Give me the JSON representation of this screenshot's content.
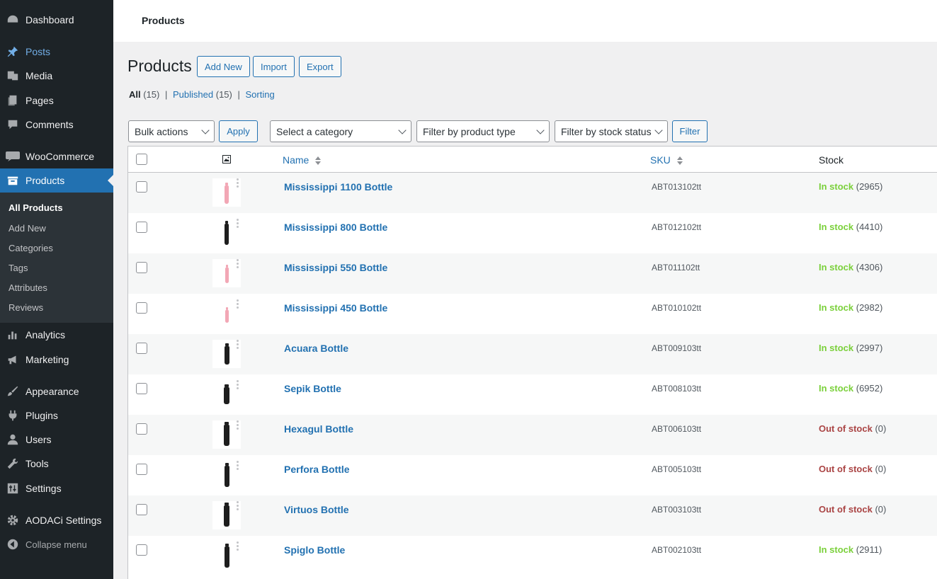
{
  "sidebar": {
    "menu": [
      {
        "label": "Dashboard",
        "icon": "dashboard-icon"
      },
      {
        "label": "Posts",
        "icon": "pin-icon"
      },
      {
        "label": "Media",
        "icon": "media-icon"
      },
      {
        "label": "Pages",
        "icon": "pages-icon"
      },
      {
        "label": "Comments",
        "icon": "comment-icon"
      },
      {
        "label": "WooCommerce",
        "icon": "woo-icon"
      },
      {
        "label": "Products",
        "icon": "archive-icon"
      },
      {
        "label": "Analytics",
        "icon": "bar-chart-icon"
      },
      {
        "label": "Marketing",
        "icon": "megaphone-icon"
      },
      {
        "label": "Appearance",
        "icon": "brush-icon"
      },
      {
        "label": "Plugins",
        "icon": "plug-icon"
      },
      {
        "label": "Users",
        "icon": "user-icon"
      },
      {
        "label": "Tools",
        "icon": "wrench-icon"
      },
      {
        "label": "Settings",
        "icon": "sliders-icon"
      },
      {
        "label": "AODACi Settings",
        "icon": "gear-icon"
      },
      {
        "label": "Collapse menu",
        "icon": "collapse-icon"
      }
    ],
    "submenu": [
      "All Products",
      "Add New",
      "Categories",
      "Tags",
      "Attributes",
      "Reviews"
    ]
  },
  "topbar": {
    "title": "Products"
  },
  "header": {
    "title": "Products",
    "add_new": "Add New",
    "import": "Import",
    "export": "Export"
  },
  "views": {
    "all": "All",
    "all_count": "(15)",
    "published": "Published",
    "published_count": "(15)",
    "sorting": "Sorting",
    "separator": "|"
  },
  "filters": {
    "bulk_actions": "Bulk actions",
    "apply": "Apply",
    "category": "Select a category",
    "product_type": "Filter by product type",
    "stock_status": "Filter by stock status",
    "filter": "Filter"
  },
  "table": {
    "columns": {
      "image": "image-icon",
      "name": "Name",
      "sku": "SKU",
      "stock": "Stock"
    },
    "rows": [
      {
        "name": "Mississippi 1100 Bottle",
        "sku": "ABT013102tt",
        "status": "In stock",
        "qty": "(2965)",
        "in_stock": true,
        "bottle_color": "#f2a7b5"
      },
      {
        "name": "Mississippi 800 Bottle",
        "sku": "ABT012102tt",
        "status": "In stock",
        "qty": "(4410)",
        "in_stock": true,
        "bottle_color": "#1e1e1e"
      },
      {
        "name": "Mississippi 550 Bottle",
        "sku": "ABT011102tt",
        "status": "In stock",
        "qty": "(4306)",
        "in_stock": true,
        "bottle_color": "#f2a7b5"
      },
      {
        "name": "Mississippi 450 Bottle",
        "sku": "ABT010102tt",
        "status": "In stock",
        "qty": "(2982)",
        "in_stock": true,
        "bottle_color": "#f2a7b5"
      },
      {
        "name": "Acuara Bottle",
        "sku": "ABT009103tt",
        "status": "In stock",
        "qty": "(2997)",
        "in_stock": true,
        "bottle_color": "#1e1e1e"
      },
      {
        "name": "Sepik Bottle",
        "sku": "ABT008103tt",
        "status": "In stock",
        "qty": "(6952)",
        "in_stock": true,
        "bottle_color": "#1e1e1e"
      },
      {
        "name": "Hexagul Bottle",
        "sku": "ABT006103tt",
        "status": "Out of stock",
        "qty": "(0)",
        "in_stock": false,
        "bottle_color": "#1e1e1e"
      },
      {
        "name": "Perfora Bottle",
        "sku": "ABT005103tt",
        "status": "Out of stock",
        "qty": "(0)",
        "in_stock": false,
        "bottle_color": "#1e1e1e"
      },
      {
        "name": "Virtuos Bottle",
        "sku": "ABT003103tt",
        "status": "Out of stock",
        "qty": "(0)",
        "in_stock": false,
        "bottle_color": "#1e1e1e"
      },
      {
        "name": "Spiglo Bottle",
        "sku": "ABT002103tt",
        "status": "In stock",
        "qty": "(2911)",
        "in_stock": true,
        "bottle_color": "#1e1e1e"
      }
    ]
  },
  "colors": {
    "accent": "#2271b1",
    "in_stock": "#7ad03a",
    "out_of_stock": "#aa4444",
    "sidebar_bg": "#1d2327"
  }
}
